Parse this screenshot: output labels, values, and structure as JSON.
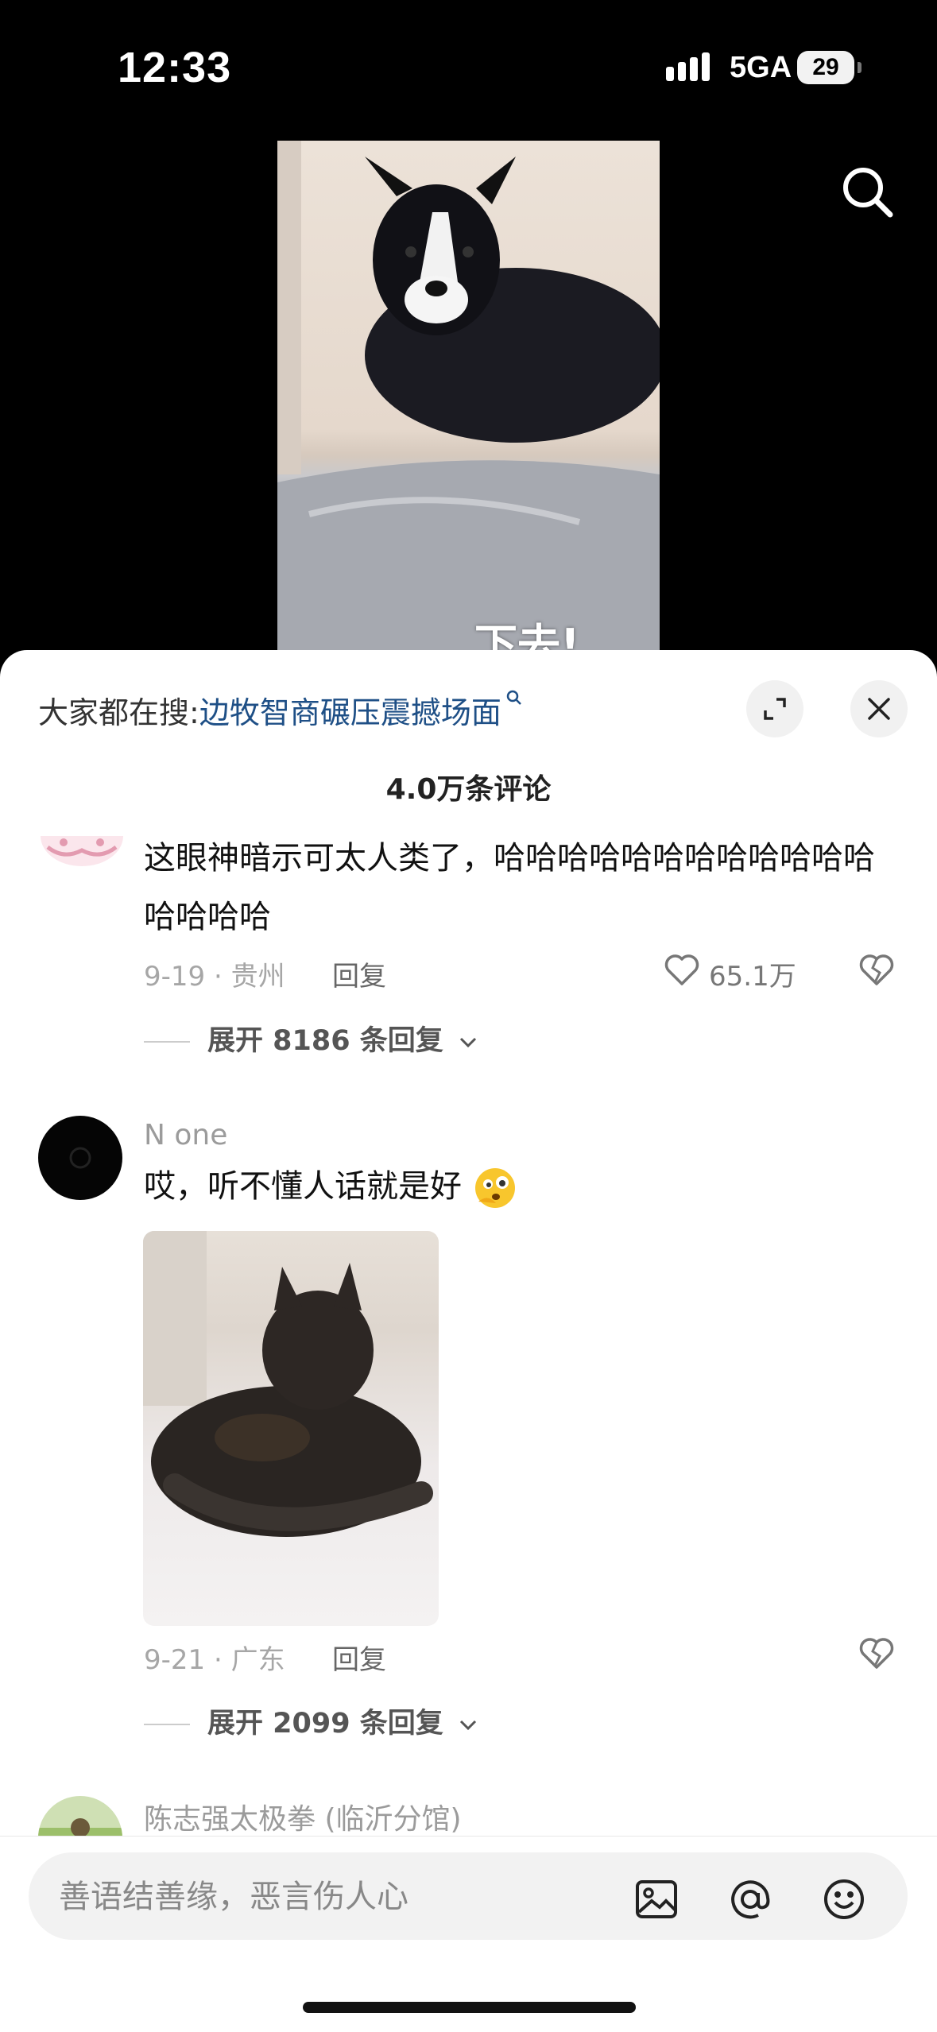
{
  "status_bar": {
    "time": "12:33",
    "network": "5GA",
    "battery": "29"
  },
  "video": {
    "caption": "下去!"
  },
  "panel": {
    "hot_search_prefix": "大家都在搜:",
    "hot_search_term": "边牧智商碾压震撼场面",
    "comment_count": "4.0万条评论",
    "comments": [
      {
        "text": "这眼神暗示可太人类了，哈哈哈哈哈哈哈哈哈哈哈哈哈哈哈哈",
        "date_location": "9-19 · 贵州",
        "reply_label": "回复",
        "likes": "65.1万",
        "expand_label": "展开 8186 条回复"
      },
      {
        "username": "N one",
        "text": "哎，听不懂人话就是好",
        "date_location": "9-21 · 广东",
        "reply_label": "回复",
        "expand_label": "展开 2099 条回复"
      },
      {
        "username": "陈志强太极拳 (临沂分馆)"
      }
    ]
  },
  "input": {
    "placeholder": "善语结善缘，恶言伤人心"
  }
}
